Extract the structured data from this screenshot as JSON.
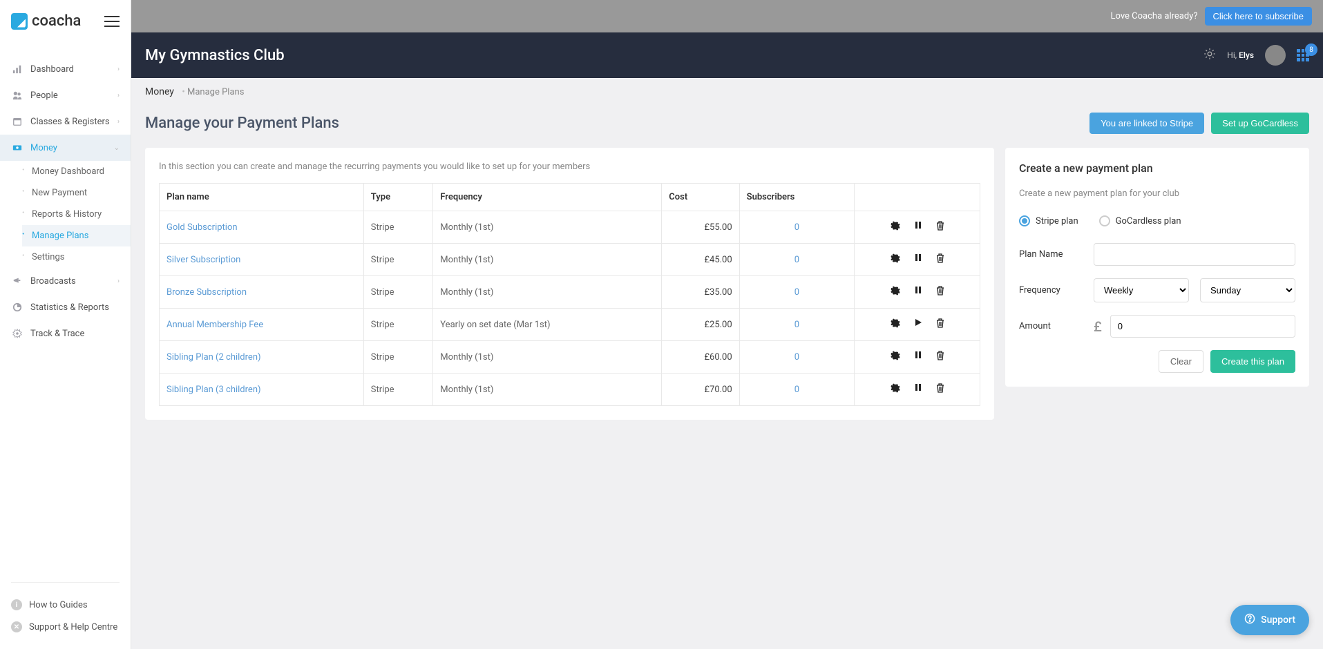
{
  "brand": "coacha",
  "sidebar": {
    "items": [
      {
        "label": "Dashboard",
        "icon": "bars"
      },
      {
        "label": "People",
        "icon": "people"
      },
      {
        "label": "Classes & Registers",
        "icon": "calendar"
      },
      {
        "label": "Money",
        "icon": "money",
        "active": true
      },
      {
        "label": "Broadcasts",
        "icon": "megaphone"
      },
      {
        "label": "Statistics & Reports",
        "icon": "pie"
      },
      {
        "label": "Track & Trace",
        "icon": "gear"
      }
    ],
    "moneySub": [
      {
        "label": "Money Dashboard"
      },
      {
        "label": "New Payment"
      },
      {
        "label": "Reports & History"
      },
      {
        "label": "Manage Plans",
        "active": true
      },
      {
        "label": "Settings"
      }
    ],
    "footer": [
      {
        "label": "How to Guides",
        "icon": "i"
      },
      {
        "label": "Support & Help Centre",
        "icon": "x"
      }
    ]
  },
  "promo": {
    "text": "Love Coacha already?",
    "button": "Click here to subscribe"
  },
  "header": {
    "clubName": "My Gymnastics Club",
    "greeting_prefix": "Hi, ",
    "userName": "Elys",
    "badge": "8"
  },
  "breadcrumb": {
    "main": "Money",
    "sub": "Manage Plans"
  },
  "page": {
    "title": "Manage your Payment Plans",
    "btnStripe": "You are linked to Stripe",
    "btnGoCardless": "Set up GoCardless",
    "description": "In this section you can create and manage the recurring payments you would like to set up for your members"
  },
  "table": {
    "headers": {
      "plan": "Plan name",
      "type": "Type",
      "frequency": "Frequency",
      "cost": "Cost",
      "subscribers": "Subscribers"
    },
    "rows": [
      {
        "name": "Gold Subscription",
        "type": "Stripe",
        "frequency": "Monthly (1st)",
        "cost": "£55.00",
        "subscribers": "0",
        "paused": false
      },
      {
        "name": "Silver Subscription",
        "type": "Stripe",
        "frequency": "Monthly (1st)",
        "cost": "£45.00",
        "subscribers": "0",
        "paused": false
      },
      {
        "name": "Bronze Subscription",
        "type": "Stripe",
        "frequency": "Monthly (1st)",
        "cost": "£35.00",
        "subscribers": "0",
        "paused": false
      },
      {
        "name": "Annual Membership Fee",
        "type": "Stripe",
        "frequency": "Yearly on set date (Mar 1st)",
        "cost": "£25.00",
        "subscribers": "0",
        "paused": true
      },
      {
        "name": "Sibling Plan (2 children)",
        "type": "Stripe",
        "frequency": "Monthly (1st)",
        "cost": "£60.00",
        "subscribers": "0",
        "paused": false
      },
      {
        "name": "Sibling Plan (3 children)",
        "type": "Stripe",
        "frequency": "Monthly (1st)",
        "cost": "£70.00",
        "subscribers": "0",
        "paused": false
      }
    ]
  },
  "form": {
    "title": "Create a new payment plan",
    "desc": "Create a new payment plan for your club",
    "radioStripe": "Stripe plan",
    "radioGoCardless": "GoCardless plan",
    "labelPlanName": "Plan Name",
    "labelFrequency": "Frequency",
    "labelAmount": "Amount",
    "freqValue": "Weekly",
    "dayValue": "Sunday",
    "amountValue": "0",
    "currency": "£",
    "btnClear": "Clear",
    "btnCreate": "Create this plan"
  },
  "support": "Support"
}
